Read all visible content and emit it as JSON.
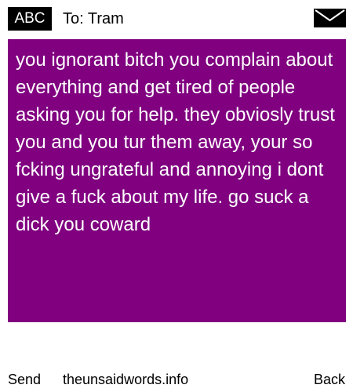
{
  "header": {
    "input_mode": "ABC",
    "recipient_label": "To: Tram",
    "message_icon": "envelope-icon"
  },
  "message": {
    "text": "you ignorant bitch you complain about everything and get tired of people asking you for help. they obviosly trust you and you tur them away, your so fcking ungrateful and annoying i dont give a fuck about my life. go suck a dick you coward"
  },
  "footer": {
    "send_label": "Send",
    "site_label": "theunsaidwords.info",
    "back_label": "Back"
  },
  "colors": {
    "message_background": "#800080",
    "message_text": "#ffffff",
    "badge_background": "#000000",
    "page_background": "#ffffff"
  }
}
